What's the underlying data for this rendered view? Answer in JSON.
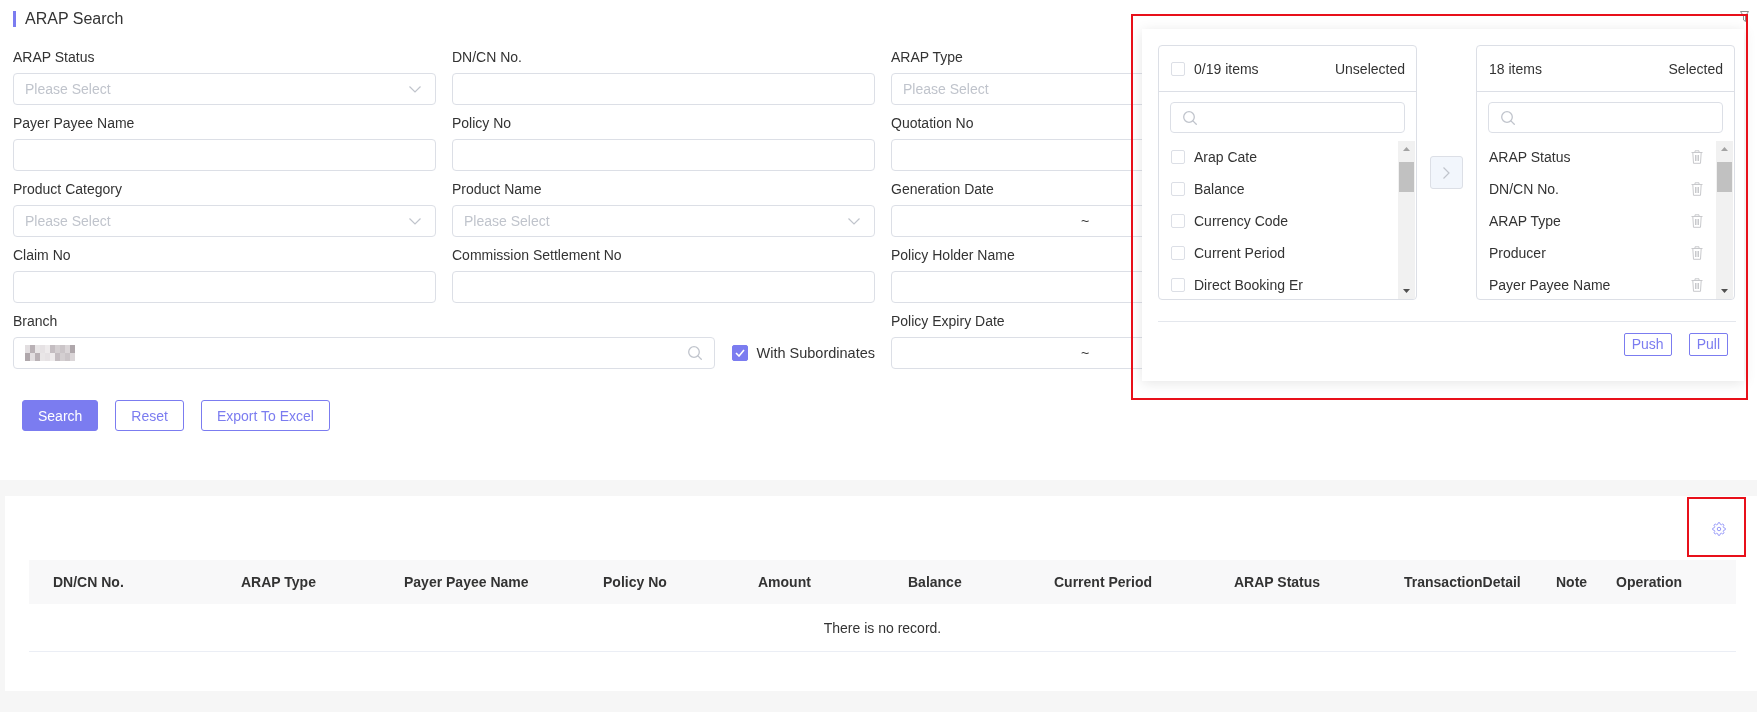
{
  "header": {
    "title": "ARAP Search"
  },
  "filters": [
    {
      "label": "ARAP Status",
      "kind": "select",
      "placeholder": "Please Select",
      "cut_off": false
    },
    {
      "label": "DN/CN No.",
      "kind": "text"
    },
    {
      "label": "ARAP Type",
      "kind": "select",
      "placeholder": "Please Select",
      "cut_off": true
    },
    {
      "label": "Payer Payee Name",
      "kind": "text"
    },
    {
      "label": "Policy No",
      "kind": "text"
    },
    {
      "label": "Quotation No",
      "kind": "text"
    },
    {
      "label": "Product Category",
      "kind": "select",
      "placeholder": "Please Select",
      "cut_off": false
    },
    {
      "label": "Product Name",
      "kind": "select",
      "placeholder": "Please Select",
      "cut_off": false
    },
    {
      "label": "Generation Date",
      "kind": "date_range",
      "separator": "~"
    },
    {
      "label": "Claim No",
      "kind": "text"
    },
    {
      "label": "Commission Settlement No",
      "kind": "text"
    },
    {
      "label": "Policy Holder Name",
      "kind": "text"
    },
    {
      "label": "Branch",
      "kind": "search",
      "value_redacted": true,
      "option": {
        "label": "With Subordinates",
        "checked": true
      }
    },
    {
      "label": "Policy Expiry Date",
      "kind": "date_range",
      "separator": "~"
    }
  ],
  "actions": [
    {
      "label": "Search",
      "primary": true
    },
    {
      "label": "Reset",
      "primary": false
    },
    {
      "label": "Export To Excel",
      "primary": false
    }
  ],
  "column_settings": {
    "highlighted": true,
    "transfer_disabled": true,
    "source": {
      "all_checked": false,
      "count": "0/19 items",
      "title": "Unselected",
      "items": [
        {
          "label": "Arap Cate",
          "checked": false
        },
        {
          "label": "Balance",
          "checked": false
        },
        {
          "label": "Currency Code",
          "checked": false
        },
        {
          "label": "Current Period",
          "checked": false
        },
        {
          "label": "Direct Booking Er",
          "checked": false
        }
      ]
    },
    "target": {
      "count": "18 items",
      "title": "Selected",
      "items": [
        {
          "label": "ARAP Status"
        },
        {
          "label": "DN/CN No."
        },
        {
          "label": "ARAP Type"
        },
        {
          "label": "Producer"
        },
        {
          "label": "Payer Payee Name"
        }
      ]
    },
    "buttons": [
      {
        "label": "Push"
      },
      {
        "label": "Pull"
      }
    ]
  },
  "table": {
    "settings_highlighted": true,
    "columns": [
      "DN/CN No.",
      "ARAP Type",
      "Payer Payee Name",
      "Policy No",
      "Amount",
      "Balance",
      "Current Period",
      "ARAP Status",
      "TransactionDetail",
      "Note",
      "Operation"
    ],
    "empty_text": "There is no record."
  }
}
